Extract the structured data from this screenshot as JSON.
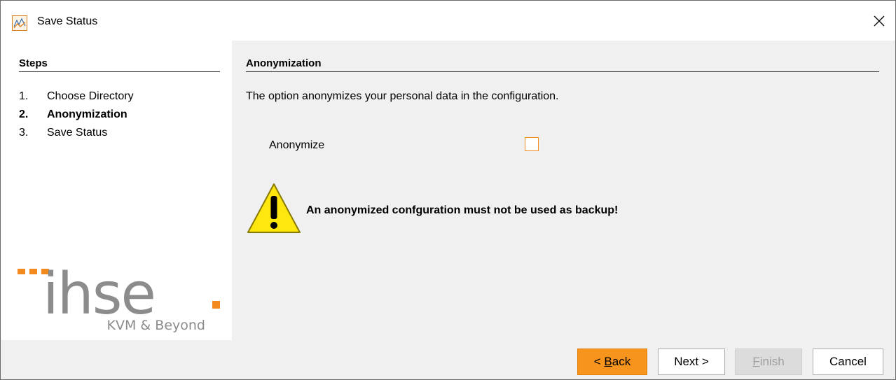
{
  "window": {
    "title": "Save Status",
    "icons": {
      "app": "app-chart-icon",
      "close": "close-icon"
    }
  },
  "steps": {
    "heading": "Steps",
    "items": [
      {
        "num": "1.",
        "label": "Choose Directory",
        "active": false
      },
      {
        "num": "2.",
        "label": "Anonymization",
        "active": true
      },
      {
        "num": "3.",
        "label": "Save Status",
        "active": false
      }
    ]
  },
  "logo": {
    "brand": "ihse",
    "tagline": "KVM & Beyond",
    "accent_color": "#f28a1d",
    "text_color": "#8c8c8c"
  },
  "content": {
    "heading": "Anonymization",
    "description": "The option anonymizes your personal data in the configuration.",
    "anonymize_label": "Anonymize",
    "anonymize_checked": false,
    "warning_icon": "warning-icon",
    "warning_text": "An anonymized confguration must not be used as backup!"
  },
  "buttons": {
    "back": {
      "prefix": "< ",
      "mnemonic": "B",
      "rest": "ack"
    },
    "next": {
      "label": "Next >"
    },
    "finish": {
      "mnemonic": "F",
      "rest": "inish",
      "enabled": false
    },
    "cancel": {
      "label": "Cancel"
    }
  },
  "colors": {
    "accent": "#f7941d",
    "checkbox_border": "#f28a1d",
    "warning_fill": "#fde70f"
  }
}
